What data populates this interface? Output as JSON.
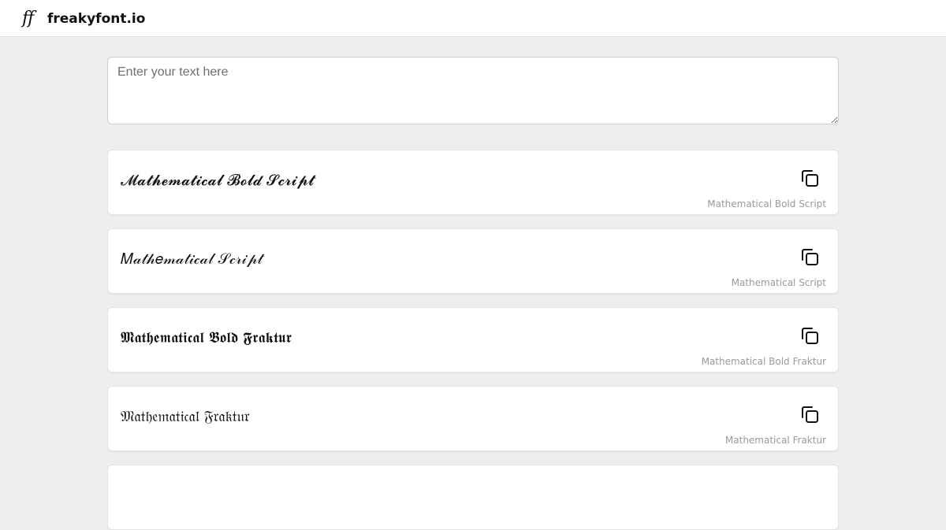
{
  "header": {
    "logo_text": "ff",
    "brand": "freakyfont.io"
  },
  "input": {
    "placeholder": "Enter your text here",
    "value": ""
  },
  "cards": [
    {
      "sample": "𝓜𝓪𝓽𝓱𝓮𝓶𝓪𝓽𝓲𝓬𝓪𝓵 𝓑𝓸𝓵𝓭 𝓢𝓬𝓻𝓲𝓹𝓽",
      "caption": "Mathematical Bold Script",
      "icon": "copy-icon"
    },
    {
      "sample": "𝑀𝒶𝓉𝒽𝑒𝓂𝒶𝓉𝒾𝒸𝒶𝓁 𝒮𝒸𝓇𝒾𝓅𝓉",
      "caption": "Mathematical Script",
      "icon": "copy-icon"
    },
    {
      "sample": "𝕸𝖆𝖙𝖍𝖊𝖒𝖆𝖙𝖎𝖈𝖆𝖑 𝕭𝖔𝖑𝖉 𝕱𝖗𝖆𝖐𝖙𝖚𝖗",
      "caption": "Mathematical Bold Fraktur",
      "icon": "copy-icon"
    },
    {
      "sample": "𝔐𝔞𝔱𝔥𝔢𝔪𝔞𝔱𝔦𝔠𝔞𝔩 𝔉𝔯𝔞𝔨𝔱𝔲𝔯",
      "caption": "Mathematical Fraktur",
      "icon": "copy-icon"
    }
  ]
}
